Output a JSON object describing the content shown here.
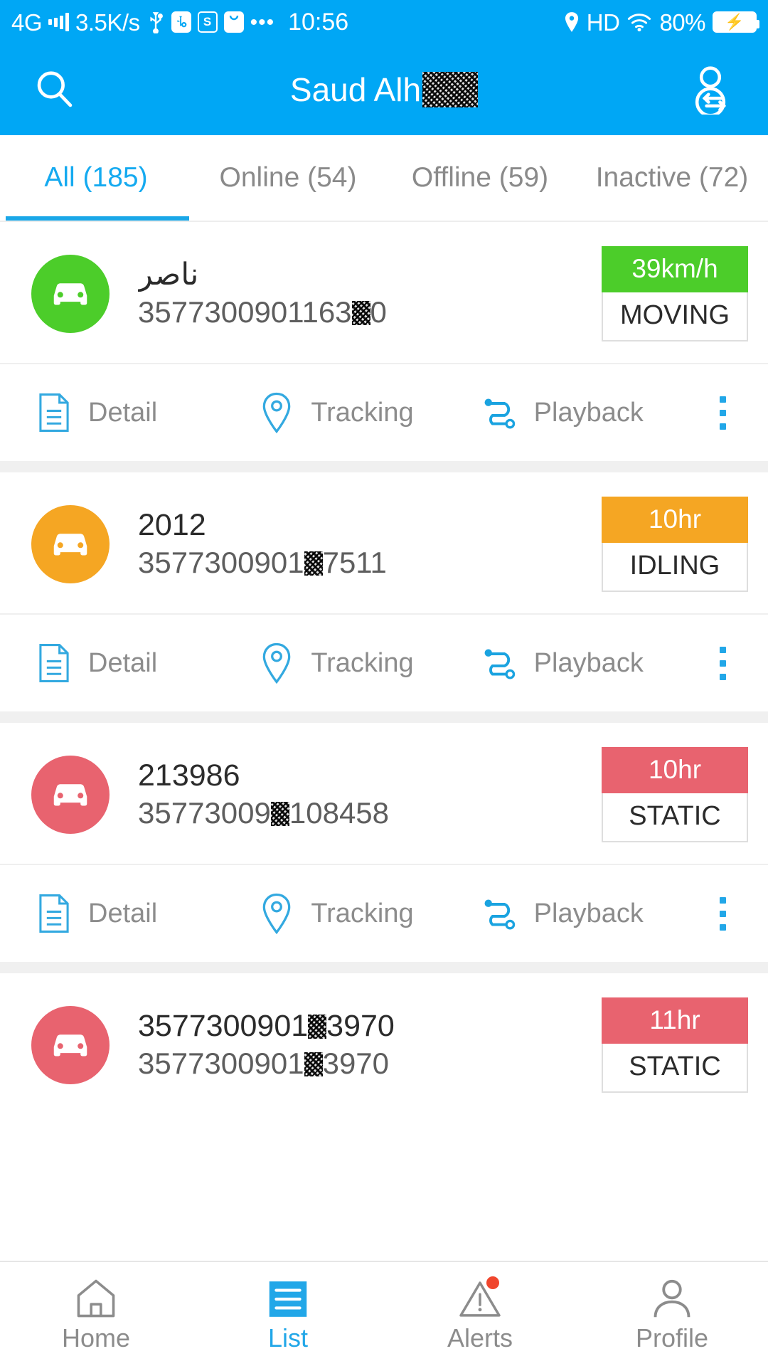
{
  "statusbar": {
    "network": "4G",
    "speed": "3.5K/s",
    "usb_icon": "usb-icon",
    "usb_debug_icon": "usb-debug-icon",
    "s_badge_icon": "s-app-icon",
    "bag_icon": "bag-app-icon",
    "more_icon": "more-dots-icon",
    "time": "10:56",
    "location_icon": "location-pin-icon",
    "hd": "HD",
    "wifi_icon": "wifi-icon",
    "battery_percent": "80%",
    "battery_icon": "battery-charging-icon"
  },
  "header": {
    "search_icon": "search-icon",
    "title": "Saud Alh",
    "title_redacted": true,
    "switch_account_icon": "switch-account-icon"
  },
  "tabs": [
    {
      "label": "All (185)",
      "active": true
    },
    {
      "label": "Online (54)",
      "active": false
    },
    {
      "label": "Offline (59)",
      "active": false
    },
    {
      "label": "Inactive (72)",
      "active": false
    }
  ],
  "actions": {
    "detail": "Detail",
    "tracking": "Tracking",
    "playback": "Playback",
    "detail_icon": "document-icon",
    "tracking_icon": "map-pin-icon",
    "playback_icon": "route-playback-icon",
    "more_icon": "kebab-menu-icon"
  },
  "colors": {
    "brand": "#00a7f5",
    "moving": "#4ccd2a",
    "idling": "#f5a623",
    "static": "#e8636f",
    "tab_active": "#15aaf0"
  },
  "devices": [
    {
      "name": "ناصر",
      "imei_prefix": "3577300901163",
      "imei_suffix": "0",
      "redacted": true,
      "metric": "39km/h",
      "state": "MOVING",
      "color": "#4ccd2a",
      "has_actions": true
    },
    {
      "name": "2012",
      "imei_prefix": "3577300901",
      "imei_suffix": "7511",
      "redacted": true,
      "metric": "10hr",
      "state": "IDLING",
      "color": "#f5a623",
      "has_actions": true
    },
    {
      "name": "213986",
      "imei_prefix": "35773009",
      "imei_suffix": "108458",
      "redacted": true,
      "metric": "10hr",
      "state": "STATIC",
      "color": "#e8636f",
      "has_actions": true
    },
    {
      "name_prefix": "3577300901",
      "name_suffix": "3970",
      "name_redacted": true,
      "imei_prefix": "3577300901",
      "imei_suffix": "3970",
      "redacted": true,
      "metric": "11hr",
      "state": "STATIC",
      "color": "#e8636f",
      "has_actions": false
    }
  ],
  "bottomnav": [
    {
      "label": "Home",
      "icon": "home-icon",
      "active": false,
      "badge": false
    },
    {
      "label": "List",
      "icon": "list-icon",
      "active": true,
      "badge": false
    },
    {
      "label": "Alerts",
      "icon": "alert-triangle-icon",
      "active": false,
      "badge": true
    },
    {
      "label": "Profile",
      "icon": "profile-person-icon",
      "active": false,
      "badge": false
    }
  ]
}
